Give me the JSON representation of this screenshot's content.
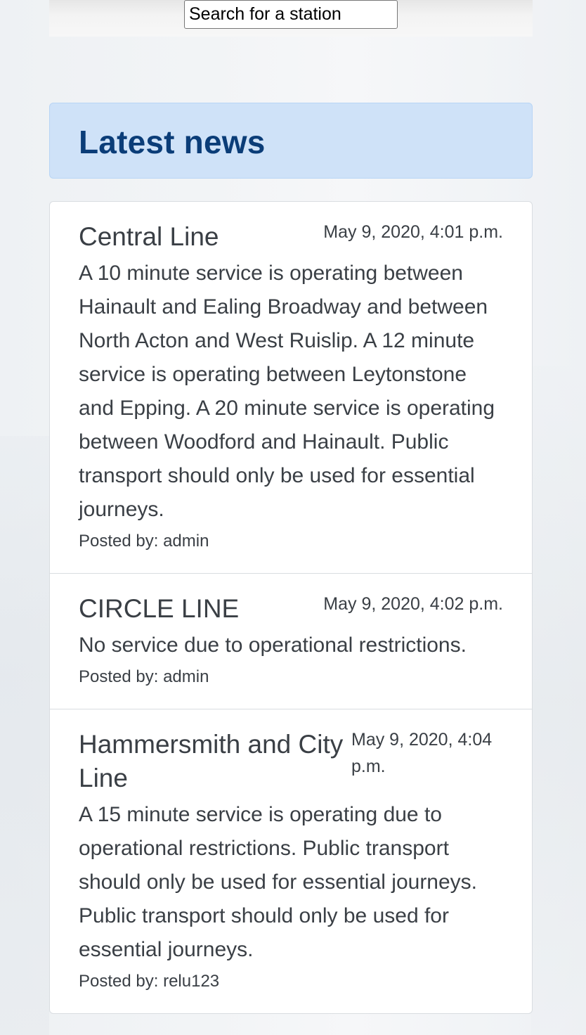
{
  "search": {
    "placeholder": "Search for a station"
  },
  "news": {
    "heading": "Latest news",
    "author_prefix": "Posted by: ",
    "items": [
      {
        "title": "Central Line",
        "date": "May 9, 2020, 4:01 p.m.",
        "body": "A 10 minute service is operating between Hainault and Ealing Broadway and between North Acton and West Ruislip. A 12 minute service is operating between Leytonstone and Epping. A 20 minute service is operating between Woodford and Hainault. Public transport should only be used for essential journeys.",
        "author": "Posted by: admin"
      },
      {
        "title": "CIRCLE LINE",
        "date": "May 9, 2020, 4:02 p.m.",
        "body": "No service due to operational restrictions.",
        "author": "Posted by: admin"
      },
      {
        "title": "Hammersmith and City Line",
        "date": "May 9, 2020, 4:04 p.m.",
        "body": "A 15 minute service is operating due to operational restrictions. Public transport should only be used for essential journeys. Public transport should only be used for essential journeys.",
        "author": "Posted by: relu123"
      }
    ]
  },
  "colors": {
    "header_bg": "#cfe2f8",
    "header_text": "#0b3d78",
    "text": "#3a3f45",
    "border": "#d9dde1"
  }
}
